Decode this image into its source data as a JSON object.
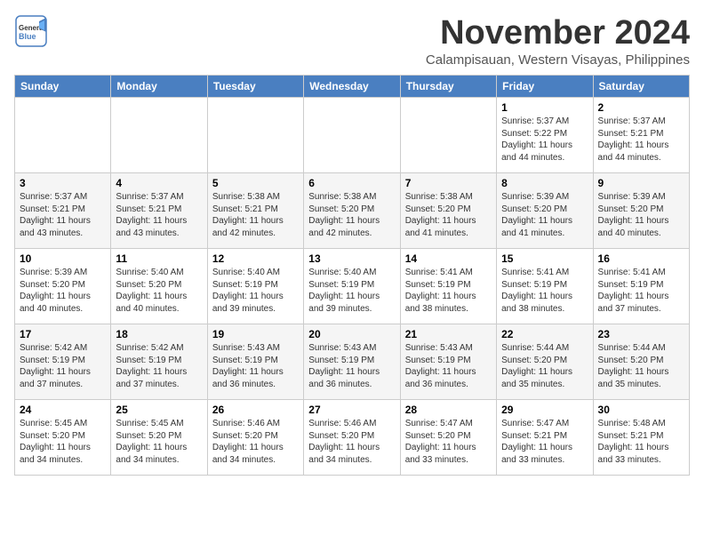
{
  "header": {
    "logo_general": "General",
    "logo_blue": "Blue",
    "month": "November 2024",
    "location": "Calampisauan, Western Visayas, Philippines"
  },
  "days_of_week": [
    "Sunday",
    "Monday",
    "Tuesday",
    "Wednesday",
    "Thursday",
    "Friday",
    "Saturday"
  ],
  "weeks": [
    [
      {
        "day": "",
        "info": ""
      },
      {
        "day": "",
        "info": ""
      },
      {
        "day": "",
        "info": ""
      },
      {
        "day": "",
        "info": ""
      },
      {
        "day": "",
        "info": ""
      },
      {
        "day": "1",
        "info": "Sunrise: 5:37 AM\nSunset: 5:22 PM\nDaylight: 11 hours and 44 minutes."
      },
      {
        "day": "2",
        "info": "Sunrise: 5:37 AM\nSunset: 5:21 PM\nDaylight: 11 hours and 44 minutes."
      }
    ],
    [
      {
        "day": "3",
        "info": "Sunrise: 5:37 AM\nSunset: 5:21 PM\nDaylight: 11 hours and 43 minutes."
      },
      {
        "day": "4",
        "info": "Sunrise: 5:37 AM\nSunset: 5:21 PM\nDaylight: 11 hours and 43 minutes."
      },
      {
        "day": "5",
        "info": "Sunrise: 5:38 AM\nSunset: 5:21 PM\nDaylight: 11 hours and 42 minutes."
      },
      {
        "day": "6",
        "info": "Sunrise: 5:38 AM\nSunset: 5:20 PM\nDaylight: 11 hours and 42 minutes."
      },
      {
        "day": "7",
        "info": "Sunrise: 5:38 AM\nSunset: 5:20 PM\nDaylight: 11 hours and 41 minutes."
      },
      {
        "day": "8",
        "info": "Sunrise: 5:39 AM\nSunset: 5:20 PM\nDaylight: 11 hours and 41 minutes."
      },
      {
        "day": "9",
        "info": "Sunrise: 5:39 AM\nSunset: 5:20 PM\nDaylight: 11 hours and 40 minutes."
      }
    ],
    [
      {
        "day": "10",
        "info": "Sunrise: 5:39 AM\nSunset: 5:20 PM\nDaylight: 11 hours and 40 minutes."
      },
      {
        "day": "11",
        "info": "Sunrise: 5:40 AM\nSunset: 5:20 PM\nDaylight: 11 hours and 40 minutes."
      },
      {
        "day": "12",
        "info": "Sunrise: 5:40 AM\nSunset: 5:19 PM\nDaylight: 11 hours and 39 minutes."
      },
      {
        "day": "13",
        "info": "Sunrise: 5:40 AM\nSunset: 5:19 PM\nDaylight: 11 hours and 39 minutes."
      },
      {
        "day": "14",
        "info": "Sunrise: 5:41 AM\nSunset: 5:19 PM\nDaylight: 11 hours and 38 minutes."
      },
      {
        "day": "15",
        "info": "Sunrise: 5:41 AM\nSunset: 5:19 PM\nDaylight: 11 hours and 38 minutes."
      },
      {
        "day": "16",
        "info": "Sunrise: 5:41 AM\nSunset: 5:19 PM\nDaylight: 11 hours and 37 minutes."
      }
    ],
    [
      {
        "day": "17",
        "info": "Sunrise: 5:42 AM\nSunset: 5:19 PM\nDaylight: 11 hours and 37 minutes."
      },
      {
        "day": "18",
        "info": "Sunrise: 5:42 AM\nSunset: 5:19 PM\nDaylight: 11 hours and 37 minutes."
      },
      {
        "day": "19",
        "info": "Sunrise: 5:43 AM\nSunset: 5:19 PM\nDaylight: 11 hours and 36 minutes."
      },
      {
        "day": "20",
        "info": "Sunrise: 5:43 AM\nSunset: 5:19 PM\nDaylight: 11 hours and 36 minutes."
      },
      {
        "day": "21",
        "info": "Sunrise: 5:43 AM\nSunset: 5:19 PM\nDaylight: 11 hours and 36 minutes."
      },
      {
        "day": "22",
        "info": "Sunrise: 5:44 AM\nSunset: 5:20 PM\nDaylight: 11 hours and 35 minutes."
      },
      {
        "day": "23",
        "info": "Sunrise: 5:44 AM\nSunset: 5:20 PM\nDaylight: 11 hours and 35 minutes."
      }
    ],
    [
      {
        "day": "24",
        "info": "Sunrise: 5:45 AM\nSunset: 5:20 PM\nDaylight: 11 hours and 34 minutes."
      },
      {
        "day": "25",
        "info": "Sunrise: 5:45 AM\nSunset: 5:20 PM\nDaylight: 11 hours and 34 minutes."
      },
      {
        "day": "26",
        "info": "Sunrise: 5:46 AM\nSunset: 5:20 PM\nDaylight: 11 hours and 34 minutes."
      },
      {
        "day": "27",
        "info": "Sunrise: 5:46 AM\nSunset: 5:20 PM\nDaylight: 11 hours and 34 minutes."
      },
      {
        "day": "28",
        "info": "Sunrise: 5:47 AM\nSunset: 5:20 PM\nDaylight: 11 hours and 33 minutes."
      },
      {
        "day": "29",
        "info": "Sunrise: 5:47 AM\nSunset: 5:21 PM\nDaylight: 11 hours and 33 minutes."
      },
      {
        "day": "30",
        "info": "Sunrise: 5:48 AM\nSunset: 5:21 PM\nDaylight: 11 hours and 33 minutes."
      }
    ]
  ]
}
